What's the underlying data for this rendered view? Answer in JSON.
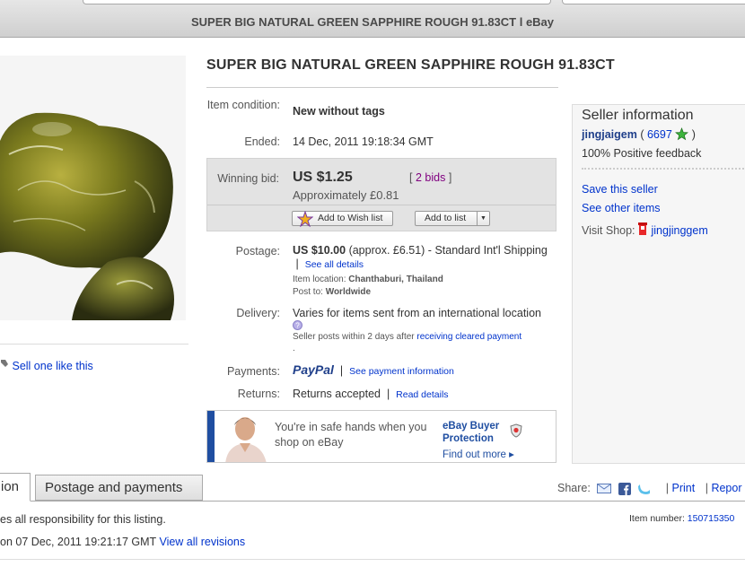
{
  "window": {
    "title": "SUPER BIG NATURAL GREEN SAPPHIRE ROUGH 91.83CT l eBay"
  },
  "item": {
    "title": "SUPER BIG NATURAL GREEN SAPPHIRE ROUGH 91.83CT",
    "sell_one_like_this": "Sell one like this",
    "condition_label": "Item condition:",
    "condition_value": "New without tags",
    "ended_label": "Ended:",
    "ended_value": "14 Dec, 2011 19:18:34 GMT"
  },
  "bid": {
    "label": "Winning bid:",
    "price": "US $1.25",
    "bids_open": "[",
    "bids_count": "2 bids",
    "bids_close": "]",
    "approx": "Approximately £0.81",
    "wish_button": "Add to Wish list",
    "list_button": "Add to list"
  },
  "postage": {
    "label": "Postage:",
    "price": "US $10.00",
    "detail": "(approx. £6.51) - Standard Int'l Shipping",
    "see_all": "See all details",
    "location_label": "Item location:",
    "location": "Chanthaburi, Thailand",
    "post_to_label": "Post to:",
    "post_to": "Worldwide"
  },
  "delivery": {
    "label": "Delivery:",
    "text": "Varies for items sent from an international location",
    "note": "Seller posts within 2 days after",
    "note_link": "receiving cleared payment",
    "note_end": "."
  },
  "payments": {
    "label": "Payments:",
    "paypal": "PayPal",
    "see_info": "See payment information"
  },
  "returns": {
    "label": "Returns:",
    "text": "Returns accepted",
    "read_details": "Read details"
  },
  "banner": {
    "message": "You're in safe hands when you shop on eBay",
    "program": "eBay Buyer Protection",
    "find_out": "Find out more ▸"
  },
  "seller": {
    "heading": "Seller information",
    "name": "jingjaigem",
    "feedback_score": "6697",
    "positive": "100% Positive feedback",
    "save": "Save this seller",
    "other_items": "See other items",
    "visit_shop_label": "Visit Shop:",
    "shop_name": "jingjinggem"
  },
  "tabs": {
    "description_partial": "ion",
    "postage": "Postage and payments"
  },
  "share": {
    "label": "Share:",
    "print": "Print",
    "report": "Repor"
  },
  "footer": {
    "responsibility": "es all responsibility for this listing.",
    "item_number_label": "Item number:",
    "item_number": "150715350",
    "revised_prefix": "on 07 Dec, 2011 19:21:17 GMT",
    "view_revisions": "View all revisions"
  },
  "colors": {
    "link": "#0033cc",
    "bids": "#800080",
    "buyer_protection": "#1f4ea1",
    "star": "#3cb43c"
  }
}
